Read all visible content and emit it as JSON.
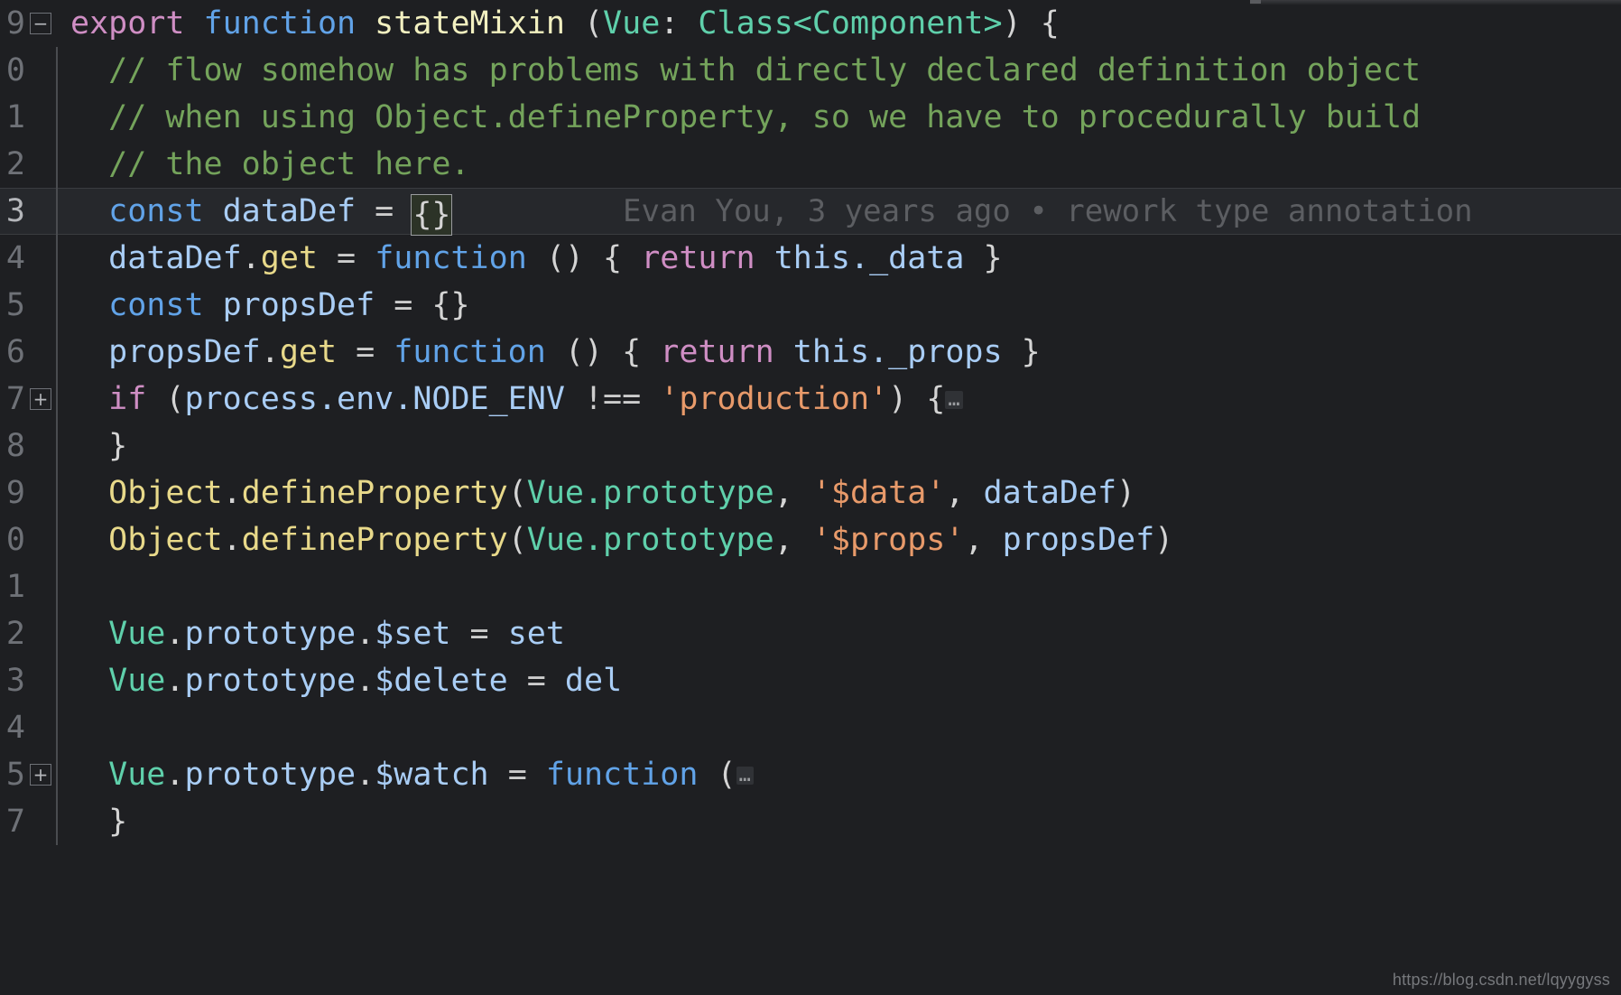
{
  "editor": {
    "theme_background": "#1e1f22",
    "active_line_background": "#26282c",
    "gutter_color": "#6e7177",
    "watermark": "https://blog.csdn.net/lqyygyss",
    "blame": {
      "author": "Evan You",
      "when": "3 years ago",
      "separator": "•",
      "message": "rework type annotation",
      "full_text": "Evan You, 3 years ago • rework type annotation"
    }
  },
  "lines": [
    {
      "number": "9",
      "fold": "minus",
      "rail": false,
      "active": false,
      "text": "export function stateMixin (Vue: Class<Component>) {"
    },
    {
      "number": "0",
      "fold": "",
      "rail": true,
      "active": false,
      "text": "  // flow somehow has problems with directly declared definition object"
    },
    {
      "number": "1",
      "fold": "",
      "rail": true,
      "active": false,
      "text": "  // when using Object.defineProperty, so we have to procedurally build"
    },
    {
      "number": "2",
      "fold": "",
      "rail": true,
      "active": false,
      "text": "  // the object here."
    },
    {
      "number": "3",
      "fold": "",
      "rail": true,
      "active": true,
      "text": "  const dataDef = {}"
    },
    {
      "number": "4",
      "fold": "",
      "rail": true,
      "active": false,
      "text": "  dataDef.get = function () { return this._data }"
    },
    {
      "number": "5",
      "fold": "",
      "rail": true,
      "active": false,
      "text": "  const propsDef = {}"
    },
    {
      "number": "6",
      "fold": "",
      "rail": true,
      "active": false,
      "text": "  propsDef.get = function () { return this._props }"
    },
    {
      "number": "7",
      "fold": "plus",
      "rail": true,
      "active": false,
      "text": "  if (process.env.NODE_ENV !== 'production') {…"
    },
    {
      "number": "8",
      "fold": "",
      "rail": true,
      "active": false,
      "text": "  }"
    },
    {
      "number": "9",
      "fold": "",
      "rail": true,
      "active": false,
      "text": "  Object.defineProperty(Vue.prototype, '$data', dataDef)"
    },
    {
      "number": "0",
      "fold": "",
      "rail": true,
      "active": false,
      "text": "  Object.defineProperty(Vue.prototype, '$props', propsDef)"
    },
    {
      "number": "1",
      "fold": "",
      "rail": true,
      "active": false,
      "text": ""
    },
    {
      "number": "2",
      "fold": "",
      "rail": true,
      "active": false,
      "text": "  Vue.prototype.$set = set"
    },
    {
      "number": "3",
      "fold": "",
      "rail": true,
      "active": false,
      "text": "  Vue.prototype.$delete = del"
    },
    {
      "number": "4",
      "fold": "",
      "rail": true,
      "active": false,
      "text": ""
    },
    {
      "number": "5",
      "fold": "plus",
      "rail": true,
      "active": false,
      "text": "  Vue.prototype.$watch = function (…"
    },
    {
      "number": "7",
      "fold": "",
      "rail": true,
      "active": false,
      "text": "  }"
    }
  ],
  "fold_glyphs": {
    "minus": "−",
    "plus": "+",
    "ellipsis": "…"
  }
}
